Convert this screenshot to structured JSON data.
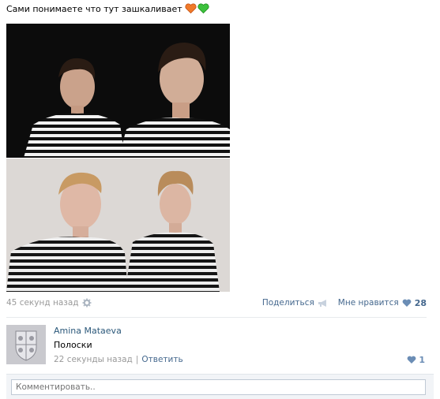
{
  "post": {
    "text": "Сами понимаете что тут зашкаливает",
    "emoji": [
      "orange-heart-icon",
      "green-heart-icon"
    ]
  },
  "meta": {
    "time": "45 секунд назад",
    "share_label": "Поделиться",
    "like_label": "Мне нравится",
    "like_count": "28"
  },
  "comment": {
    "author": "Amina Mataeva",
    "text": "Полоски",
    "time": "22 секунды назад",
    "separator": "|",
    "reply": "Ответить",
    "like_count": "1"
  },
  "comment_input": {
    "placeholder": "Комментировать.."
  },
  "colors": {
    "link": "#45688e",
    "muted": "#999999",
    "heart_orange": "#f07a2a",
    "heart_green": "#3cc13c"
  }
}
